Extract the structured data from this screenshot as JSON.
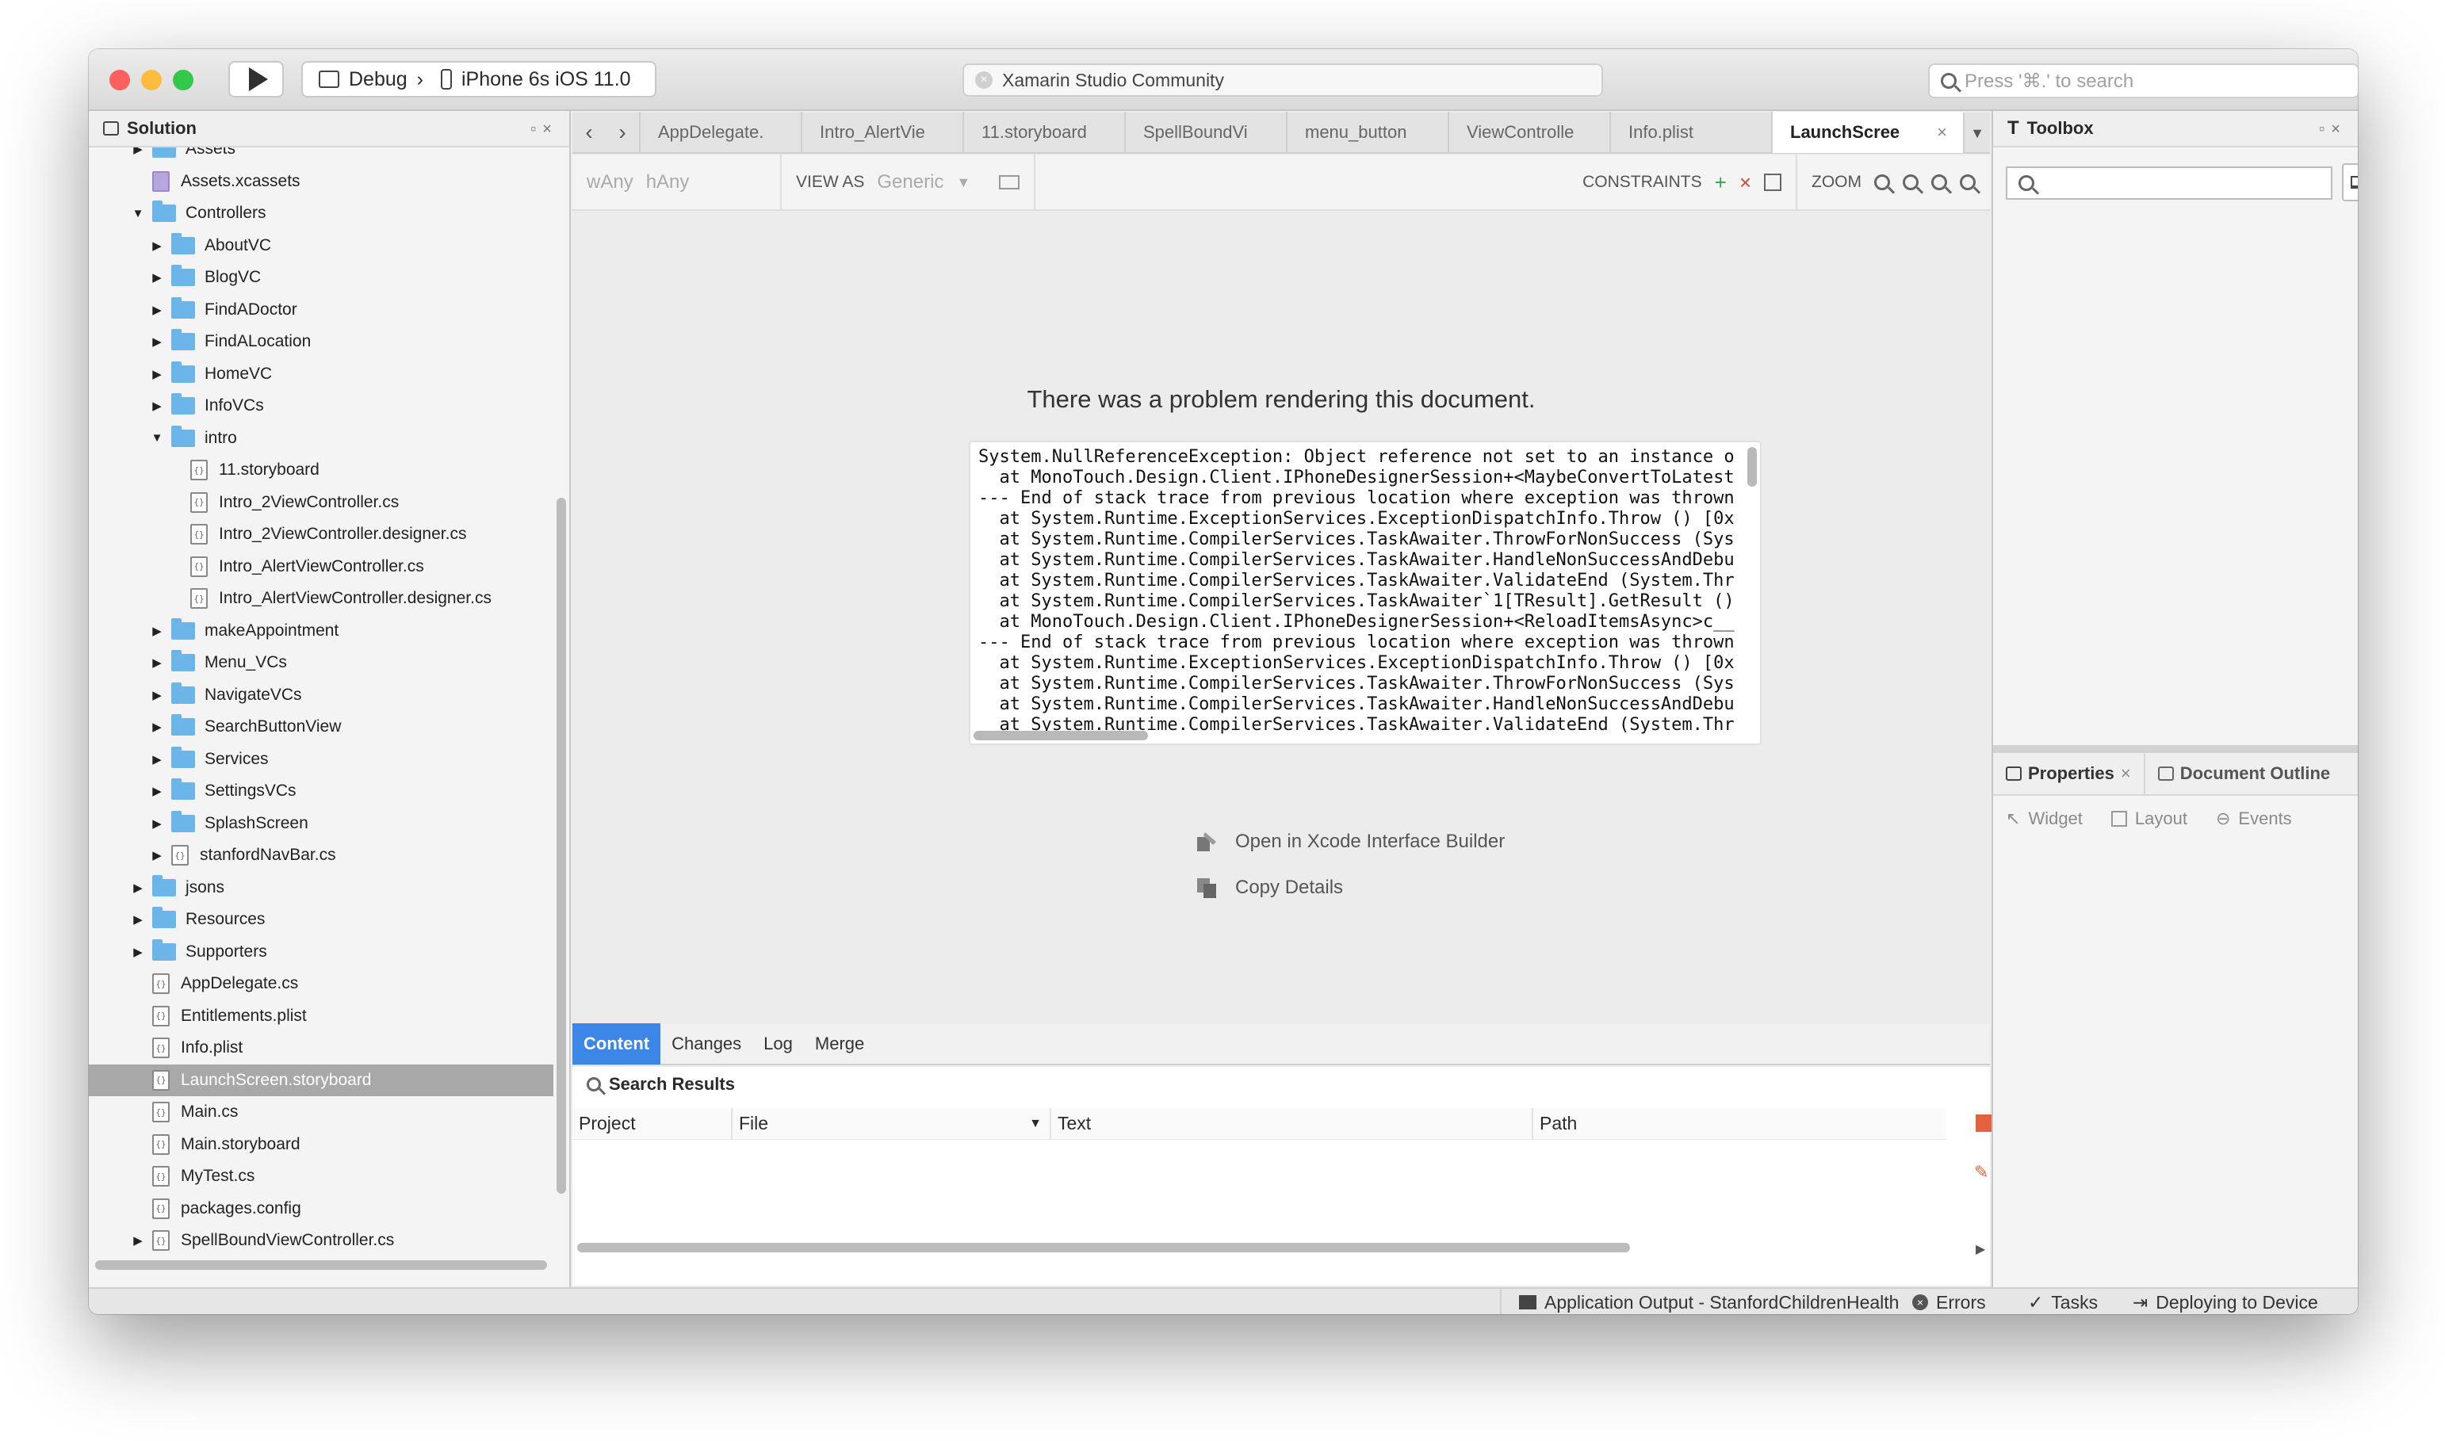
{
  "window": {
    "scheme": {
      "config": "Debug",
      "separator": "›",
      "device": "iPhone 6s iOS 11.0"
    },
    "title": "Xamarin Studio Community",
    "search_placeholder": "Press '⌘.' to search"
  },
  "solution": {
    "title": "Solution",
    "items": [
      {
        "label": "Assets",
        "type": "folder",
        "depth": 1,
        "state": "collapsed"
      },
      {
        "label": "Assets.xcassets",
        "type": "asset",
        "depth": 1,
        "state": "none"
      },
      {
        "label": "Controllers",
        "type": "folder",
        "depth": 1,
        "state": "expanded"
      },
      {
        "label": "AboutVC",
        "type": "folder",
        "depth": 2,
        "state": "collapsed"
      },
      {
        "label": "BlogVC",
        "type": "folder",
        "depth": 2,
        "state": "collapsed"
      },
      {
        "label": "FindADoctor",
        "type": "folder",
        "depth": 2,
        "state": "collapsed"
      },
      {
        "label": "FindALocation",
        "type": "folder",
        "depth": 2,
        "state": "collapsed"
      },
      {
        "label": "HomeVC",
        "type": "folder",
        "depth": 2,
        "state": "collapsed"
      },
      {
        "label": "InfoVCs",
        "type": "folder",
        "depth": 2,
        "state": "collapsed"
      },
      {
        "label": "intro",
        "type": "folder",
        "depth": 2,
        "state": "expanded"
      },
      {
        "label": "11.storyboard",
        "type": "file",
        "depth": 3,
        "state": "none"
      },
      {
        "label": "Intro_2ViewController.cs",
        "type": "file",
        "depth": 3,
        "state": "none"
      },
      {
        "label": "Intro_2ViewController.designer.cs",
        "type": "file",
        "depth": 3,
        "state": "none"
      },
      {
        "label": "Intro_AlertViewController.cs",
        "type": "file",
        "depth": 3,
        "state": "none"
      },
      {
        "label": "Intro_AlertViewController.designer.cs",
        "type": "file",
        "depth": 3,
        "state": "none"
      },
      {
        "label": "makeAppointment",
        "type": "folder",
        "depth": 2,
        "state": "collapsed"
      },
      {
        "label": "Menu_VCs",
        "type": "folder",
        "depth": 2,
        "state": "collapsed"
      },
      {
        "label": "NavigateVCs",
        "type": "folder",
        "depth": 2,
        "state": "collapsed"
      },
      {
        "label": "SearchButtonView",
        "type": "folder",
        "depth": 2,
        "state": "collapsed"
      },
      {
        "label": "Services",
        "type": "folder",
        "depth": 2,
        "state": "collapsed"
      },
      {
        "label": "SettingsVCs",
        "type": "folder",
        "depth": 2,
        "state": "collapsed"
      },
      {
        "label": "SplashScreen",
        "type": "folder",
        "depth": 2,
        "state": "collapsed"
      },
      {
        "label": "stanfordNavBar.cs",
        "type": "file",
        "depth": 2,
        "state": "collapsed"
      },
      {
        "label": "jsons",
        "type": "folder",
        "depth": 1,
        "state": "collapsed"
      },
      {
        "label": "Resources",
        "type": "folder",
        "depth": 1,
        "state": "collapsed"
      },
      {
        "label": "Supporters",
        "type": "folder",
        "depth": 1,
        "state": "collapsed"
      },
      {
        "label": "AppDelegate.cs",
        "type": "file",
        "depth": 1,
        "state": "none"
      },
      {
        "label": "Entitlements.plist",
        "type": "file",
        "depth": 1,
        "state": "none"
      },
      {
        "label": "Info.plist",
        "type": "file",
        "depth": 1,
        "state": "none"
      },
      {
        "label": "LaunchScreen.storyboard",
        "type": "file",
        "depth": 1,
        "state": "none",
        "selected": true
      },
      {
        "label": "Main.cs",
        "type": "file",
        "depth": 1,
        "state": "none"
      },
      {
        "label": "Main.storyboard",
        "type": "file",
        "depth": 1,
        "state": "none"
      },
      {
        "label": "MyTest.cs",
        "type": "file",
        "depth": 1,
        "state": "none"
      },
      {
        "label": "packages.config",
        "type": "file",
        "depth": 1,
        "state": "none"
      },
      {
        "label": "SpellBoundViewController.cs",
        "type": "file",
        "depth": 1,
        "state": "collapsed"
      }
    ]
  },
  "editor": {
    "tabs": [
      "AppDelegate.",
      "Intro_AlertVie",
      "11.storyboard",
      "SpellBoundVi",
      "menu_button",
      "ViewControlle",
      "Info.plist"
    ],
    "active_tab": "LaunchScree",
    "toolbar": {
      "size_w": "wAny",
      "size_h": "hAny",
      "view_as_label": "VIEW AS",
      "view_as_value": "Generic",
      "constraints_label": "CONSTRAINTS",
      "zoom_label": "ZOOM"
    },
    "problem_title": "There was a problem rendering this document.",
    "stack_trace": [
      "System.NullReferenceException: Object reference not set to an instance o",
      "  at MonoTouch.Design.Client.IPhoneDesignerSession+<MaybeConvertToLatest",
      "--- End of stack trace from previous location where exception was thrown",
      "  at System.Runtime.ExceptionServices.ExceptionDispatchInfo.Throw () [0x",
      "  at System.Runtime.CompilerServices.TaskAwaiter.ThrowForNonSuccess (Sys",
      "  at System.Runtime.CompilerServices.TaskAwaiter.HandleNonSuccessAndDebu",
      "  at System.Runtime.CompilerServices.TaskAwaiter.ValidateEnd (System.Thr",
      "  at System.Runtime.CompilerServices.TaskAwaiter`1[TResult].GetResult ()",
      "  at MonoTouch.Design.Client.IPhoneDesignerSession+<ReloadItemsAsync>c__",
      "--- End of stack trace from previous location where exception was thrown",
      "  at System.Runtime.ExceptionServices.ExceptionDispatchInfo.Throw () [0x",
      "  at System.Runtime.CompilerServices.TaskAwaiter.ThrowForNonSuccess (Sys",
      "  at System.Runtime.CompilerServices.TaskAwaiter.HandleNonSuccessAndDebu",
      "  at System.Runtime.CompilerServices.TaskAwaiter.ValidateEnd (System.Thr"
    ],
    "actions": {
      "open_xcode": "Open in Xcode Interface Builder",
      "copy_details": "Copy Details"
    },
    "bottom_tabs": [
      "Content",
      "Changes",
      "Log",
      "Merge"
    ]
  },
  "search_results": {
    "title": "Search Results",
    "columns": [
      "Project",
      "File",
      "Text",
      "Path"
    ]
  },
  "toolbox": {
    "title": "Toolbox",
    "search_placeholder": ""
  },
  "properties": {
    "tab_properties": "Properties",
    "tab_outline": "Document Outline",
    "subtabs": [
      "Widget",
      "Layout",
      "Events"
    ]
  },
  "statusbar": {
    "app_output": "Application Output - StanfordChildrenHealth",
    "errors": "Errors",
    "tasks": "Tasks",
    "deploying": "Deploying to Device"
  },
  "colors": {
    "accent": "#3b86e6",
    "folder": "#6cb5e8",
    "stop": "#e4613f"
  }
}
